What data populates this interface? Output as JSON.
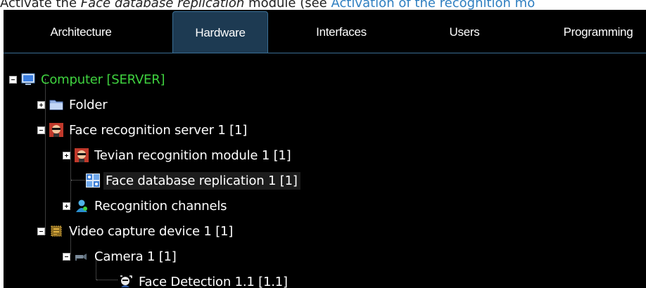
{
  "caption": {
    "prefix": "Activate the ",
    "module": "Face database replication",
    "middle": " module (see ",
    "link": "Activation of the recognition mo"
  },
  "tabs": [
    {
      "label": "Architecture",
      "active": false
    },
    {
      "label": "Hardware",
      "active": true
    },
    {
      "label": "Interfaces",
      "active": false
    },
    {
      "label": "Users",
      "active": false
    },
    {
      "label": "Programming",
      "active": false
    }
  ],
  "tree": {
    "computer": "Computer [SERVER]",
    "folder": "Folder",
    "face_server": "Face recognition server 1 [1]",
    "tevian": "Tevian recognition module 1 [1]",
    "replication": "Face database replication 1 [1]",
    "channels": "Recognition channels",
    "video_device": "Video capture device 1 [1]",
    "camera": "Camera 1 [1]",
    "face_detection": "Face Detection 1.1 [1.1]"
  },
  "colors": {
    "background": "#000000",
    "root_text": "#3fd23f",
    "active_tab": "#1d3a52",
    "link": "#2f7fc1"
  }
}
